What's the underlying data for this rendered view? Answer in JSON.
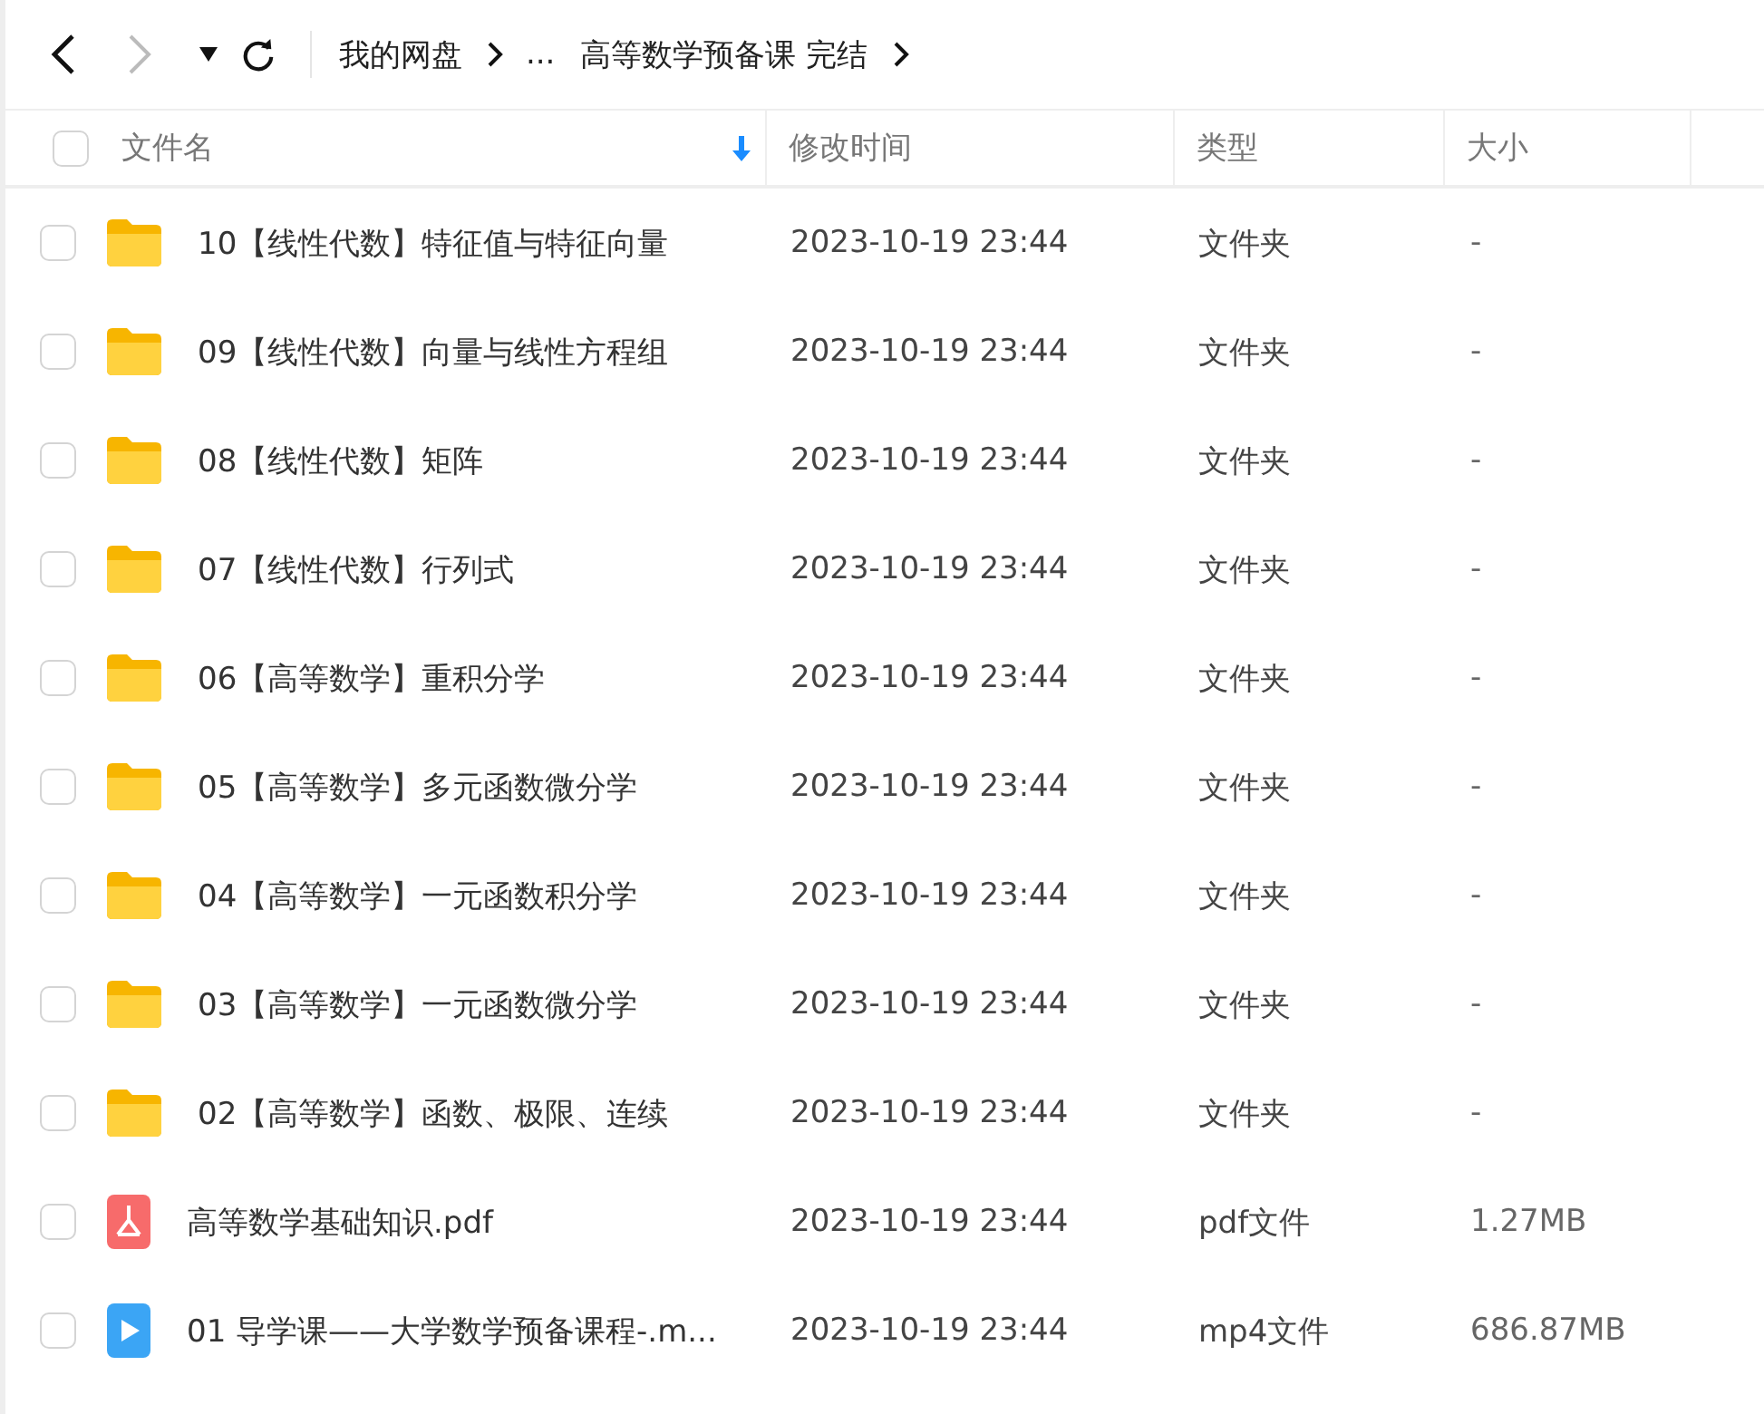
{
  "nav": {
    "back_disabled": false,
    "forward_disabled": true
  },
  "breadcrumb": [
    "我的网盘",
    "...",
    "高等数学预备课 完结"
  ],
  "columns": [
    {
      "label": "文件名",
      "sorted": true
    },
    {
      "label": "修改时间",
      "sorted": false
    },
    {
      "label": "类型",
      "sorted": false
    },
    {
      "label": "大小",
      "sorted": false
    }
  ],
  "select_all": {
    "checked": false
  },
  "rows": [
    {
      "kind": "folder",
      "checked": false,
      "name": "10【线性代数】特征值与特征向量",
      "modified": "2023-10-19 23:44",
      "type": "文件夹",
      "size": "-"
    },
    {
      "kind": "folder",
      "checked": false,
      "name": "09【线性代数】向量与线性方程组",
      "modified": "2023-10-19 23:44",
      "type": "文件夹",
      "size": "-"
    },
    {
      "kind": "folder",
      "checked": false,
      "name": "08【线性代数】矩阵",
      "modified": "2023-10-19 23:44",
      "type": "文件夹",
      "size": "-"
    },
    {
      "kind": "folder",
      "checked": false,
      "name": "07【线性代数】行列式",
      "modified": "2023-10-19 23:44",
      "type": "文件夹",
      "size": "-"
    },
    {
      "kind": "folder",
      "checked": false,
      "name": "06【高等数学】重积分学",
      "modified": "2023-10-19 23:44",
      "type": "文件夹",
      "size": "-"
    },
    {
      "kind": "folder",
      "checked": false,
      "name": "05【高等数学】多元函数微分学",
      "modified": "2023-10-19 23:44",
      "type": "文件夹",
      "size": "-"
    },
    {
      "kind": "folder",
      "checked": false,
      "name": "04【高等数学】一元函数积分学",
      "modified": "2023-10-19 23:44",
      "type": "文件夹",
      "size": "-"
    },
    {
      "kind": "folder",
      "checked": false,
      "name": "03【高等数学】一元函数微分学",
      "modified": "2023-10-19 23:44",
      "type": "文件夹",
      "size": "-"
    },
    {
      "kind": "folder",
      "checked": false,
      "name": "02【高等数学】函数、极限、连续",
      "modified": "2023-10-19 23:44",
      "type": "文件夹",
      "size": "-"
    },
    {
      "kind": "pdf",
      "checked": false,
      "name": "高等数学基础知识.pdf",
      "modified": "2023-10-19 23:44",
      "type": "pdf文件",
      "size": "1.27MB"
    },
    {
      "kind": "video",
      "checked": false,
      "name": "01 导学课——大学数学预备课程-.m...",
      "modified": "2023-10-19 23:44",
      "type": "mp4文件",
      "size": "686.87MB"
    }
  ]
}
